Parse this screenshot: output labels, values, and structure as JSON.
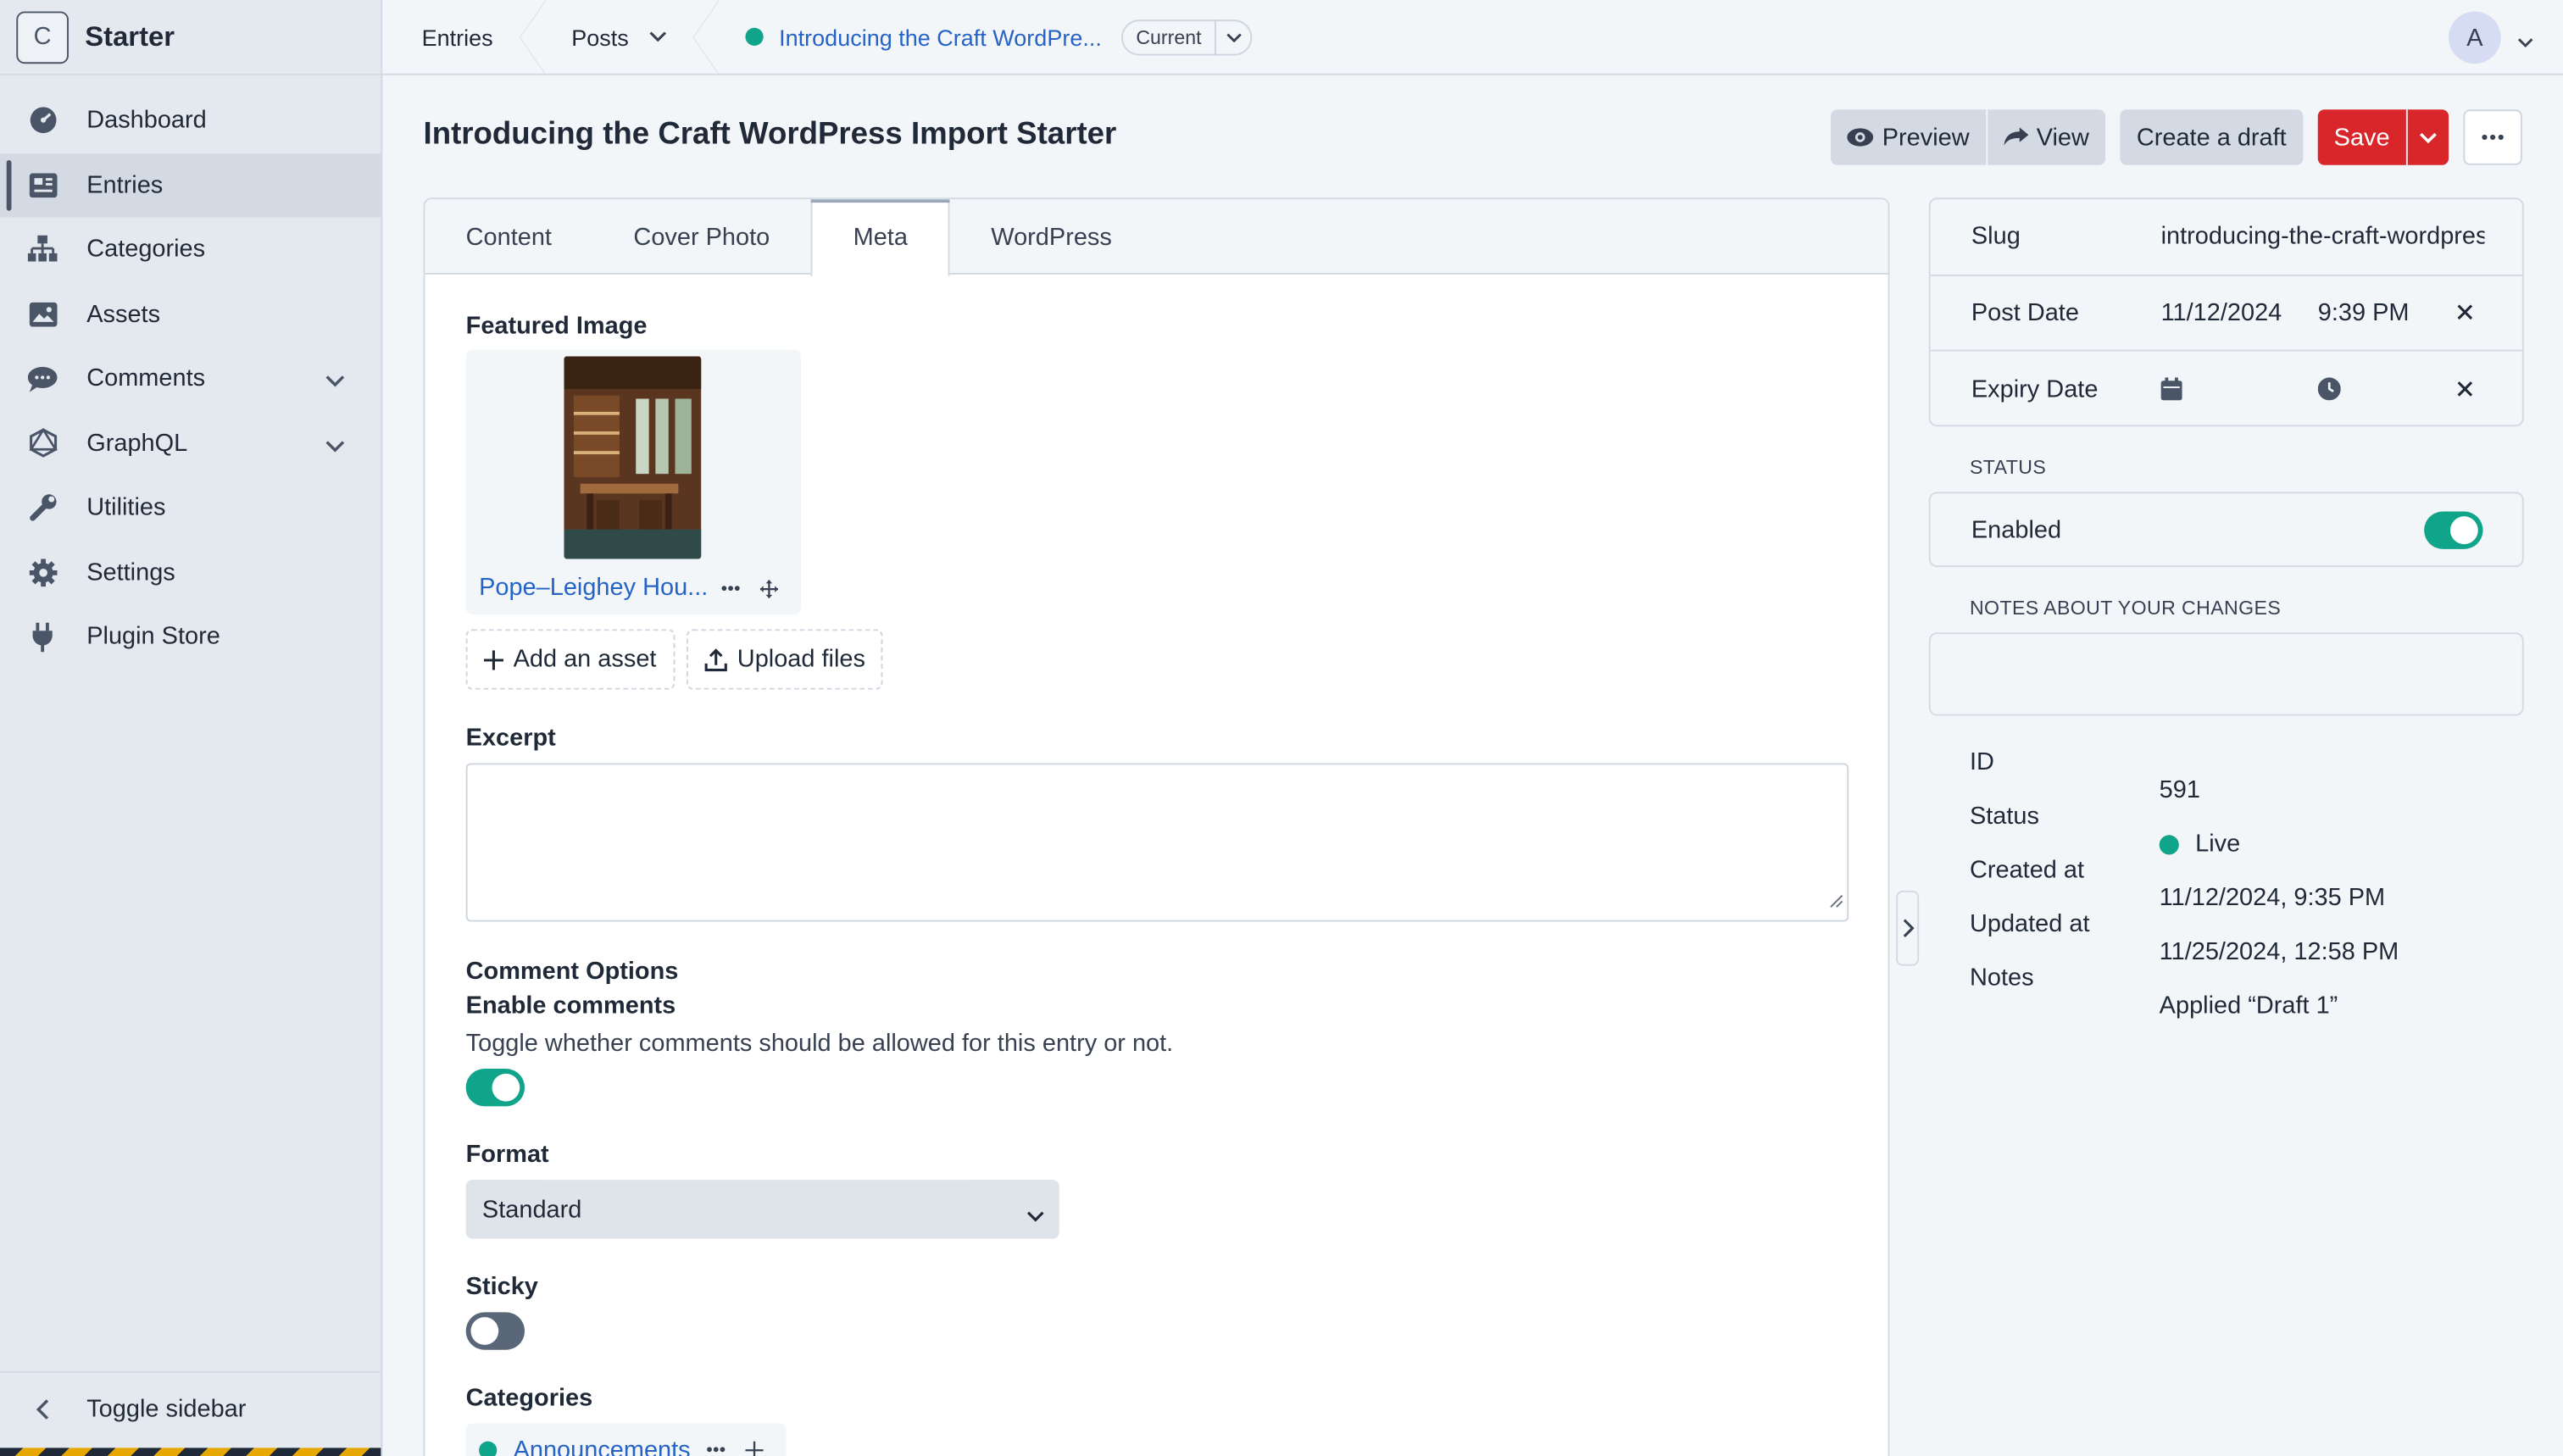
{
  "app": {
    "logo_letter": "C",
    "site_name": "Starter"
  },
  "sidebar": {
    "items": [
      {
        "label": "Dashboard",
        "icon": "dashboard-icon"
      },
      {
        "label": "Entries",
        "icon": "entries-icon",
        "active": true
      },
      {
        "label": "Categories",
        "icon": "categories-icon"
      },
      {
        "label": "Assets",
        "icon": "assets-icon"
      },
      {
        "label": "Comments",
        "icon": "comments-icon",
        "expandable": true
      },
      {
        "label": "GraphQL",
        "icon": "graphql-icon",
        "expandable": true
      },
      {
        "label": "Utilities",
        "icon": "wrench-icon"
      },
      {
        "label": "Settings",
        "icon": "gear-icon"
      },
      {
        "label": "Plugin Store",
        "icon": "plug-icon"
      }
    ],
    "toggle_label": "Toggle sidebar"
  },
  "breadcrumb": {
    "entries": "Entries",
    "posts": "Posts",
    "entry": "Introducing the Craft WordPre...",
    "revision": "Current"
  },
  "user": {
    "initial": "A"
  },
  "page": {
    "title": "Introducing the Craft WordPress Import Starter"
  },
  "toolbar": {
    "preview": "Preview",
    "view": "View",
    "create_draft": "Create a draft",
    "save": "Save",
    "more": "···"
  },
  "tabs": [
    {
      "label": "Content"
    },
    {
      "label": "Cover Photo"
    },
    {
      "label": "Meta",
      "active": true
    },
    {
      "label": "WordPress"
    }
  ],
  "fields": {
    "featured_image_label": "Featured Image",
    "asset_name": "Pope–Leighey Hou...",
    "add_asset": "Add an asset",
    "upload_files": "Upload files",
    "excerpt_label": "Excerpt",
    "excerpt_value": "",
    "comment_options_label": "Comment Options",
    "enable_comments_label": "Enable comments",
    "enable_comments_help": "Toggle whether comments should be allowed for this entry or not.",
    "enable_comments_on": true,
    "format_label": "Format",
    "format_value": "Standard",
    "sticky_label": "Sticky",
    "sticky_on": false,
    "categories_label": "Categories",
    "category_name": "Announcements"
  },
  "meta": {
    "slug_label": "Slug",
    "slug_value": "introducing-the-craft-wordpress-import-starter",
    "post_date_label": "Post Date",
    "post_date": "11/12/2024",
    "post_time": "9:39 PM",
    "expiry_date_label": "Expiry Date"
  },
  "status": {
    "heading": "STATUS",
    "enabled_label": "Enabled",
    "enabled": true
  },
  "notes": {
    "heading": "NOTES ABOUT YOUR CHANGES",
    "value": ""
  },
  "info": {
    "id_label": "ID",
    "id": "591",
    "status_label": "Status",
    "status": "Live",
    "created_label": "Created at",
    "created": "11/12/2024, 9:35 PM",
    "updated_label": "Updated at",
    "updated": "11/25/2024, 12:58 PM",
    "notes_label": "Notes",
    "notes": "Applied “Draft 1”"
  },
  "colors": {
    "accent": "#10a58a",
    "save": "#d9262a",
    "link": "#2563c7"
  }
}
